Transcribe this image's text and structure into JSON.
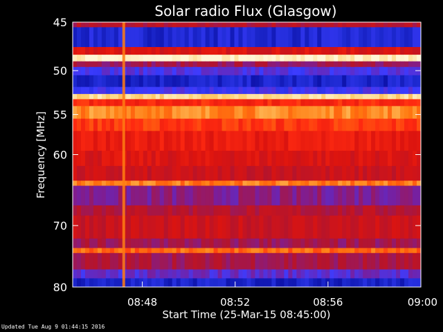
{
  "chart_data": {
    "type": "heatmap",
    "title": "Solar radio Flux (Glasgow)",
    "ylabel": "Frequency [MHz]",
    "xlabel": "Start Time (25-Mar-15 08:45:00)",
    "y_ticks": [
      45,
      50,
      55,
      60,
      70,
      80
    ],
    "x_ticks": [
      "08:48",
      "08:52",
      "08:56",
      "09:00"
    ],
    "x_tick_minutes": [
      3,
      7,
      11,
      15
    ],
    "xlim_minutes": [
      0,
      15
    ],
    "ylim_mhz": [
      45,
      80
    ],
    "y_scale": "log",
    "colormap": [
      "#00008c",
      "#1e2ad2",
      "#3c3cff",
      "#7a1e9a",
      "#b4142d",
      "#dc140f",
      "#ff2a10",
      "#ff7a10",
      "#ffd070",
      "#fff6d8"
    ],
    "bands_mhz": [
      {
        "f0": 45.0,
        "f1": 45.5,
        "level": 0.45
      },
      {
        "f0": 45.5,
        "f1": 47.5,
        "level": 0.12
      },
      {
        "f0": 47.5,
        "f1": 48.3,
        "level": 0.55
      },
      {
        "f0": 48.3,
        "f1": 49.0,
        "level": 0.98
      },
      {
        "f0": 49.0,
        "f1": 49.6,
        "level": 0.4
      },
      {
        "f0": 49.6,
        "f1": 50.5,
        "level": 0.25
      },
      {
        "f0": 50.5,
        "f1": 51.8,
        "level": 0.1
      },
      {
        "f0": 51.8,
        "f1": 52.6,
        "level": 0.22
      },
      {
        "f0": 52.6,
        "f1": 53.2,
        "level": 0.92
      },
      {
        "f0": 53.2,
        "f1": 54.0,
        "level": 0.65
      },
      {
        "f0": 54.0,
        "f1": 55.5,
        "level": 0.8
      },
      {
        "f0": 55.5,
        "f1": 57.0,
        "level": 0.68
      },
      {
        "f0": 57.0,
        "f1": 59.5,
        "level": 0.6
      },
      {
        "f0": 59.5,
        "f1": 61.5,
        "level": 0.55
      },
      {
        "f0": 61.5,
        "f1": 63.5,
        "level": 0.5
      },
      {
        "f0": 63.5,
        "f1": 64.2,
        "level": 0.78
      },
      {
        "f0": 64.2,
        "f1": 67.0,
        "level": 0.35
      },
      {
        "f0": 67.0,
        "f1": 68.5,
        "level": 0.45
      },
      {
        "f0": 68.5,
        "f1": 72.0,
        "level": 0.5
      },
      {
        "f0": 72.0,
        "f1": 73.5,
        "level": 0.4
      },
      {
        "f0": 73.5,
        "f1": 74.3,
        "level": 0.75
      },
      {
        "f0": 74.3,
        "f1": 77.0,
        "level": 0.42
      },
      {
        "f0": 77.0,
        "f1": 78.5,
        "level": 0.28
      },
      {
        "f0": 78.5,
        "f1": 80.0,
        "level": 0.1
      }
    ],
    "burst_minutes": 2.2
  },
  "footer": "Updated Tue Aug  9 01:44:15 2016",
  "colors": {
    "background": "#000000",
    "axis": "#ffffff"
  }
}
